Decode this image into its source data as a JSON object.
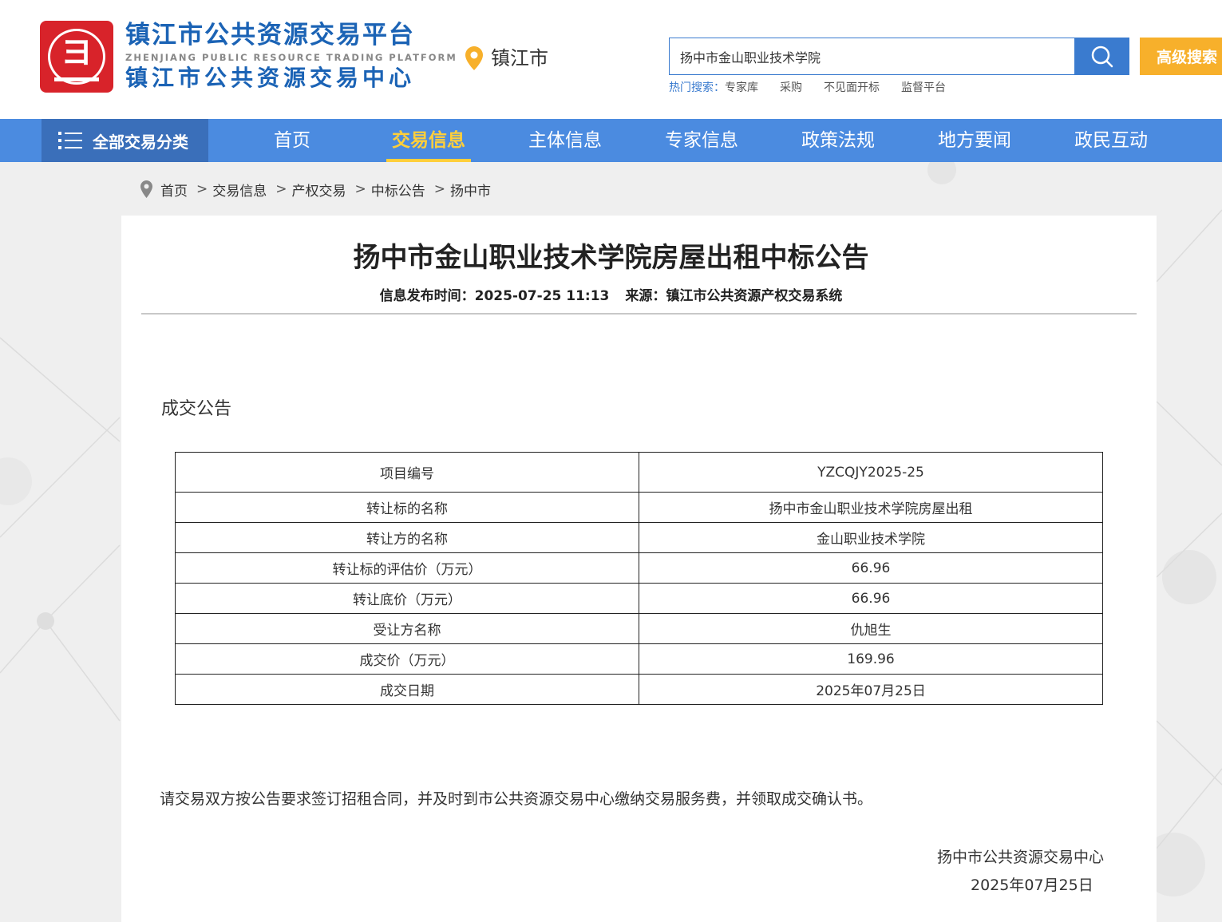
{
  "header": {
    "logo_cn_top": "镇江市公共资源交易平台",
    "logo_en": "ZHENJIANG PUBLIC RESOURCE TRADING PLATFORM",
    "logo_cn_bottom": "镇江市公共资源交易中心",
    "city": "镇江市",
    "search": {
      "value": "扬中市金山职业技术学院",
      "button_icon": "search-icon"
    },
    "advanced_search_label": "高级搜索",
    "hot_search": {
      "label": "热门搜索：",
      "links": [
        "专家库",
        "采购",
        "不见面开标",
        "监督平台"
      ]
    }
  },
  "nav": {
    "all_label": "全部交易分类",
    "items": [
      {
        "label": "首页",
        "active": false
      },
      {
        "label": "交易信息",
        "active": true
      },
      {
        "label": "主体信息",
        "active": false
      },
      {
        "label": "专家信息",
        "active": false
      },
      {
        "label": "政策法规",
        "active": false
      },
      {
        "label": "地方要闻",
        "active": false
      },
      {
        "label": "政民互动",
        "active": false
      }
    ]
  },
  "breadcrumb": [
    "首页",
    "交易信息",
    "产权交易",
    "中标公告",
    "扬中市"
  ],
  "article": {
    "title": "扬中市金山职业技术学院房屋出租中标公告",
    "publish_label": "信息发布时间：",
    "publish_time": "2025-07-25 11:13",
    "source_label": "来源：",
    "source": "镇江市公共资源产权交易系统",
    "section_title": "成交公告",
    "table": [
      {
        "label": "项目编号",
        "value": "YZCQJY2025-25"
      },
      {
        "label": "转让标的名称",
        "value": "扬中市金山职业技术学院房屋出租"
      },
      {
        "label": "转让方的名称",
        "value": "金山职业技术学院"
      },
      {
        "label": "转让标的评估价（万元）",
        "value": "66.96"
      },
      {
        "label": "转让底价（万元）",
        "value": "66.96"
      },
      {
        "label": "受让方名称",
        "value": "仇旭生"
      },
      {
        "label": "成交价（万元）",
        "value": "169.96"
      },
      {
        "label": "成交日期",
        "value": "2025年07月25日"
      }
    ],
    "notice": "请交易双方按公告要求签订招租合同，并及时到市公共资源交易中心缴纳交易服务费，并领取成交确认书。",
    "signer": "扬中市公共资源交易中心",
    "sign_date": "2025年07月25日"
  },
  "colors": {
    "brand_blue": "#3a7bcf",
    "nav_blue": "#4b8be0",
    "nav_active": "#ffcf3a",
    "advanced_button": "#f7b02b",
    "logo_red": "#d8232a"
  }
}
